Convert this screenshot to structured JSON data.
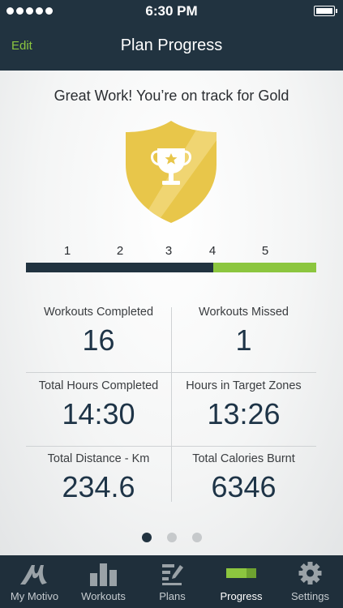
{
  "status_bar": {
    "time": "6:30 PM"
  },
  "nav": {
    "edit_label": "Edit",
    "title": "Plan Progress"
  },
  "headline": "Great Work! You’re on track for Gold",
  "progress": {
    "labels": [
      "1",
      "2",
      "3",
      "4",
      "5"
    ],
    "completed_fraction": 0.645
  },
  "stats": [
    {
      "label": "Workouts Completed",
      "value": "16"
    },
    {
      "label": "Workouts Missed",
      "value": "1"
    },
    {
      "label": "Total Hours Completed",
      "value": "14:30"
    },
    {
      "label": "Hours in Target Zones",
      "value": "13:26"
    },
    {
      "label": "Total Distance - Km",
      "value": "234.6"
    },
    {
      "label": "Total Calories Burnt",
      "value": "6346"
    }
  ],
  "pager": {
    "pages": 3,
    "current": 1
  },
  "tabs": [
    {
      "label": "My Motivo",
      "icon": "motivo-logo-icon"
    },
    {
      "label": "Workouts",
      "icon": "bar-chart-icon"
    },
    {
      "label": "Plans",
      "icon": "plan-edit-icon"
    },
    {
      "label": "Progress",
      "icon": "progress-bar-icon",
      "active": true
    },
    {
      "label": "Settings",
      "icon": "gear-icon"
    }
  ],
  "colors": {
    "accent_green": "#8cc63f",
    "navy": "#213340",
    "gold": "#e8c64a",
    "value_text": "#1e3447"
  }
}
